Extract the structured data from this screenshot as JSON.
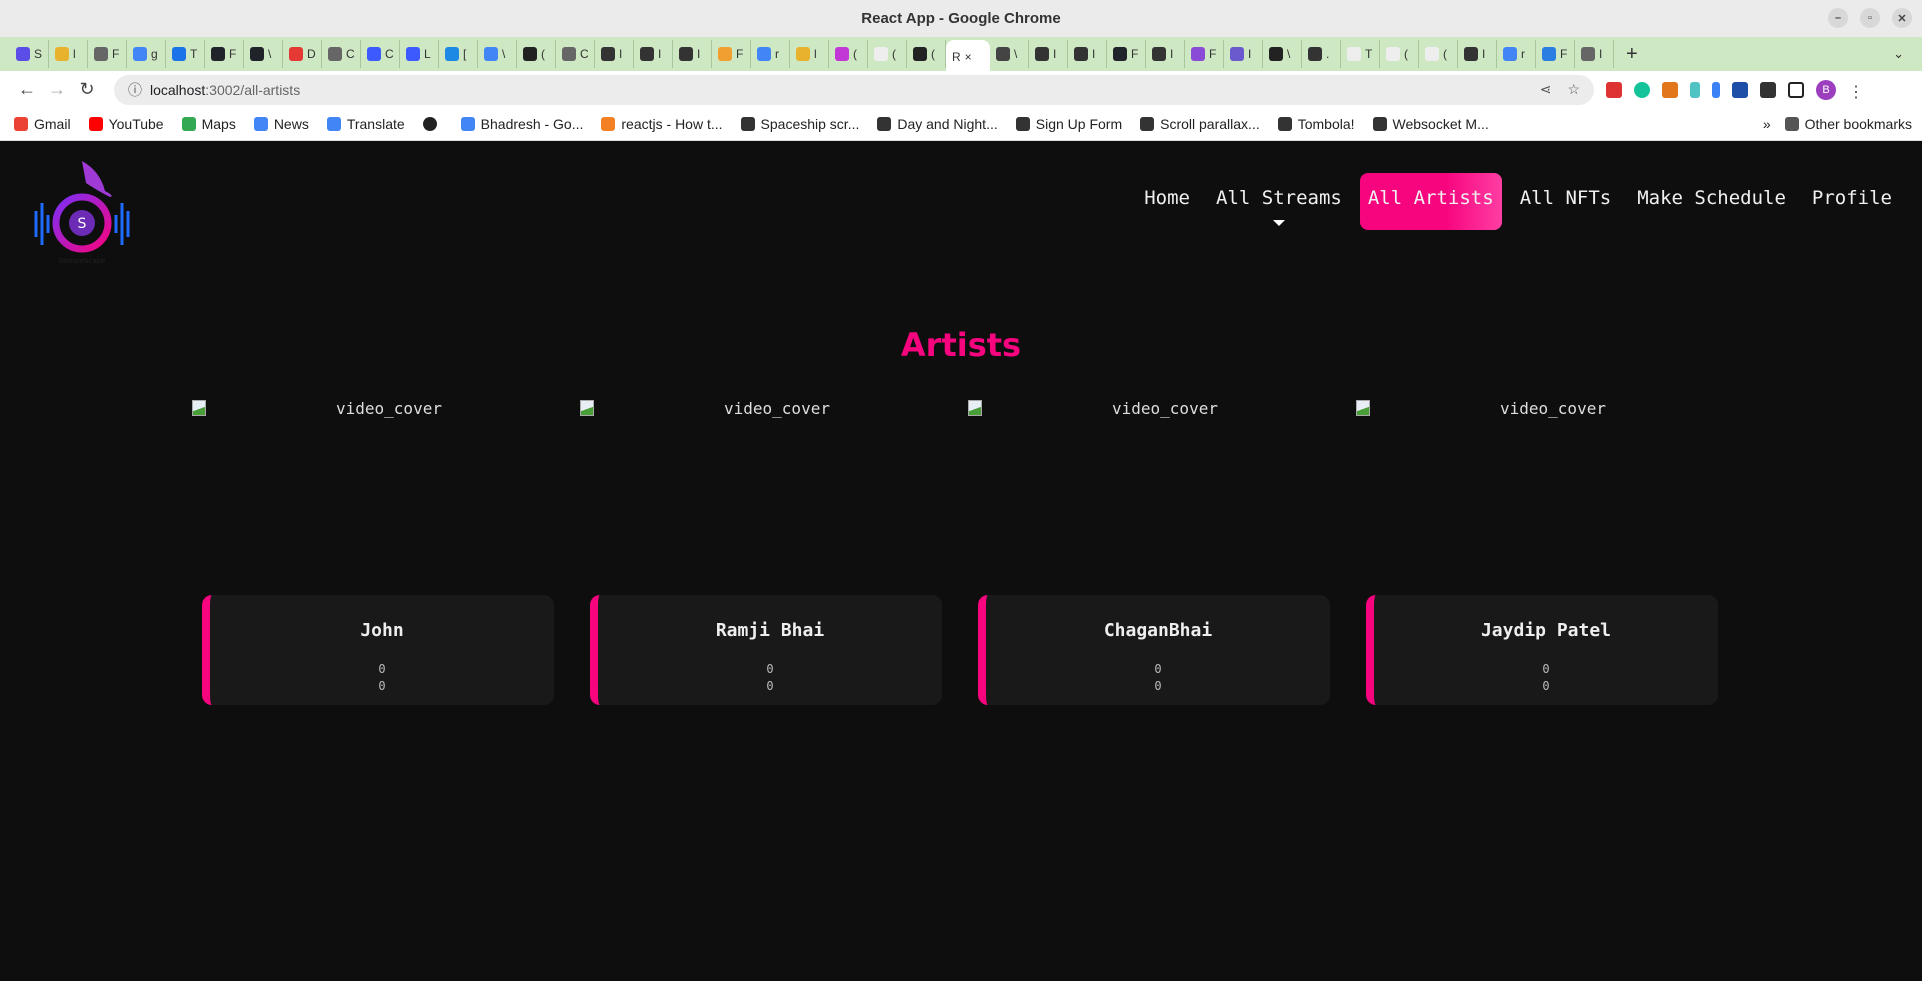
{
  "window": {
    "title": "React App - Google Chrome"
  },
  "tabs": [
    {
      "label": "S",
      "color": "#5b4ee8"
    },
    {
      "label": "l",
      "color": "#e8b22e"
    },
    {
      "label": "F",
      "color": "#666"
    },
    {
      "label": "g",
      "color": "#4285f4"
    },
    {
      "label": "T",
      "color": "#1a73e8"
    },
    {
      "label": "F",
      "color": "#20232a"
    },
    {
      "label": "\\",
      "color": "#20232a"
    },
    {
      "label": "D",
      "color": "#e53935"
    },
    {
      "label": "C",
      "color": "#666"
    },
    {
      "label": "C",
      "color": "#3d5afe"
    },
    {
      "label": "L",
      "color": "#3d5afe"
    },
    {
      "label": "[",
      "color": "#1e88e5"
    },
    {
      "label": "\\",
      "color": "#4285f4"
    },
    {
      "label": "(",
      "color": "#222"
    },
    {
      "label": "C",
      "color": "#666"
    },
    {
      "label": "I",
      "color": "#333"
    },
    {
      "label": "I",
      "color": "#333"
    },
    {
      "label": "I",
      "color": "#333"
    },
    {
      "label": "F",
      "color": "#f0a030"
    },
    {
      "label": "r",
      "color": "#4285f4"
    },
    {
      "label": "l",
      "color": "#e8b22e"
    },
    {
      "label": "(",
      "color": "#c238d6"
    },
    {
      "label": "(",
      "color": "#eee"
    },
    {
      "label": "(",
      "color": "#222"
    },
    {
      "label": "R",
      "color": "#fff",
      "active": true
    },
    {
      "label": "\\",
      "color": "#444"
    },
    {
      "label": "I",
      "color": "#333"
    },
    {
      "label": "I",
      "color": "#333"
    },
    {
      "label": "F",
      "color": "#20232a"
    },
    {
      "label": "I",
      "color": "#333"
    },
    {
      "label": "F",
      "color": "#8a4bd6"
    },
    {
      "label": "I",
      "color": "#6a5acd"
    },
    {
      "label": "\\",
      "color": "#222"
    },
    {
      "label": ".",
      "color": "#333"
    },
    {
      "label": "T",
      "color": "#eee"
    },
    {
      "label": "(",
      "color": "#eee"
    },
    {
      "label": "(",
      "color": "#eee"
    },
    {
      "label": "I",
      "color": "#333"
    },
    {
      "label": "r",
      "color": "#4285f4"
    },
    {
      "label": "F",
      "color": "#2a7de1"
    },
    {
      "label": "I",
      "color": "#666"
    }
  ],
  "tab_close": "×",
  "new_tab": "+",
  "tab_menu": "⌄",
  "address": {
    "host": "localhost",
    "path": ":3002/all-artists"
  },
  "bookmarks": [
    {
      "label": "Gmail",
      "color": "#ea4335"
    },
    {
      "label": "YouTube",
      "color": "#ff0000"
    },
    {
      "label": "Maps",
      "color": "#34a853"
    },
    {
      "label": "News",
      "color": "#4285f4"
    },
    {
      "label": "Translate",
      "color": "#4285f4"
    },
    {
      "label": "",
      "color": "#222"
    },
    {
      "label": "Bhadresh - Go...",
      "color": "#4285f4"
    },
    {
      "label": "reactjs - How t...",
      "color": "#f48024"
    },
    {
      "label": "Spaceship scr...",
      "color": "#333"
    },
    {
      "label": "Day and Night...",
      "color": "#333"
    },
    {
      "label": "Sign Up Form",
      "color": "#333"
    },
    {
      "label": "Scroll parallax...",
      "color": "#333"
    },
    {
      "label": "Tombola!",
      "color": "#333"
    },
    {
      "label": "Websocket M...",
      "color": "#333"
    }
  ],
  "bookmarks_more": "»",
  "other_bookmarks": "Other bookmarks",
  "profile_initial": "B",
  "app": {
    "logo_text": "StreamScape",
    "nav": [
      {
        "label": "Home"
      },
      {
        "label": "All Streams",
        "dropdown": true
      },
      {
        "label": "All Artists",
        "active": true
      },
      {
        "label": "All NFTs"
      },
      {
        "label": "Make Schedule"
      },
      {
        "label": "Profile"
      }
    ],
    "heading": "Artists",
    "accent": "#f7047f",
    "covers": [
      {
        "alt": "video_cover"
      },
      {
        "alt": "video_cover"
      },
      {
        "alt": "video_cover"
      },
      {
        "alt": "video_cover"
      }
    ],
    "artists": [
      {
        "name": "John",
        "stat1": "0",
        "stat2": "0"
      },
      {
        "name": "Ramji Bhai",
        "stat1": "0",
        "stat2": "0"
      },
      {
        "name": "ChaganBhai",
        "stat1": "0",
        "stat2": "0"
      },
      {
        "name": "Jaydip Patel",
        "stat1": "0",
        "stat2": "0"
      }
    ]
  }
}
